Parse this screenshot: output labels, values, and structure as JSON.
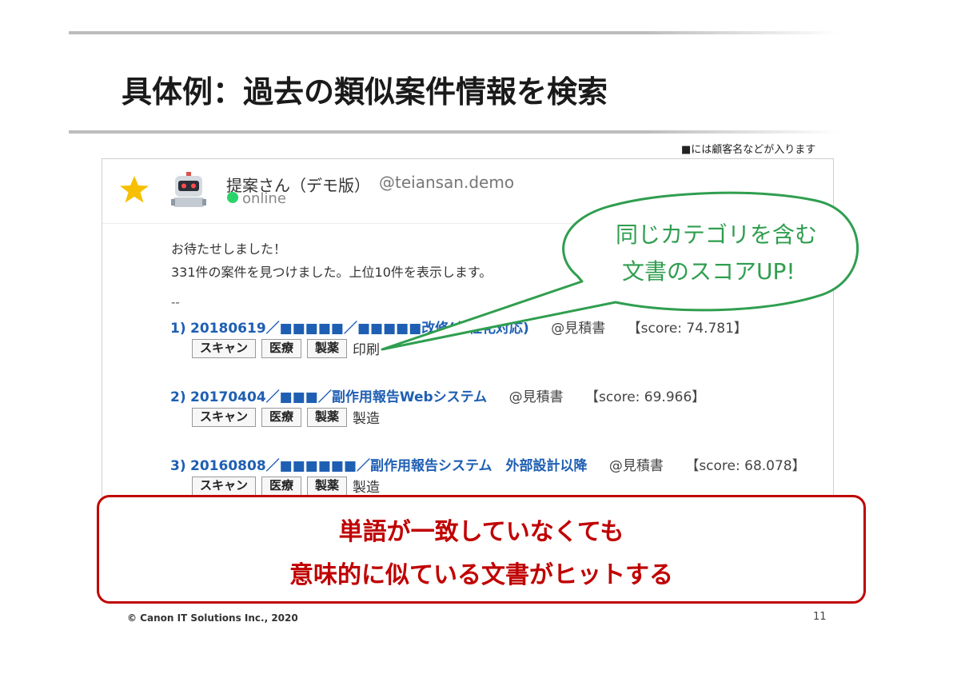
{
  "slide": {
    "title": "具体例：過去の類似案件情報を検索",
    "footnote": "■には顧客名などが入ります",
    "copyright": "© Canon IT Solutions Inc., 2020",
    "page_number": "11"
  },
  "chat": {
    "bot_name": "提案さん（デモ版）",
    "bot_handle": "@teiansan.demo",
    "status": "online",
    "greeting": "お待たせしました！",
    "count_message": "331件の案件を見つけました。上位10件を表示します。",
    "separator": "--",
    "results": [
      {
        "rank": "1)",
        "title": "20180619／■■■■■／■■■■■改修(分社化対応)",
        "source": "@見積書",
        "score": "【score: 74.781】",
        "tags": [
          "スキャン",
          "医療",
          "製薬"
        ],
        "extra": "印刷"
      },
      {
        "rank": "2)",
        "title": "20170404／■■■／副作用報告Webシステム",
        "source": "@見積書",
        "score": "【score: 69.966】",
        "tags": [
          "スキャン",
          "医療",
          "製薬"
        ],
        "extra": "製造"
      },
      {
        "rank": "3)",
        "title": "20160808／■■■■■■／副作用報告システム　外部設計以降",
        "source": "@見積書",
        "score": "【score: 68.078】",
        "tags": [
          "スキャン",
          "医療",
          "製薬"
        ],
        "extra": "製造"
      }
    ]
  },
  "balloon": {
    "line1": "同じカテゴリを含む",
    "line2": "文書のスコアUP!"
  },
  "callout": {
    "line1": "単語が一致していなくても",
    "line2": "意味的に似ている文書がヒットする"
  },
  "colors": {
    "link_blue": "#1f5fb3",
    "balloon_green": "#2f9e4f",
    "callout_red": "#c00000",
    "online_green": "#2bd46a",
    "star_yellow": "#f6c000"
  },
  "icons": {
    "favorite": "star-icon",
    "bot": "robot-avatar-icon",
    "presence": "online-dot-icon"
  }
}
